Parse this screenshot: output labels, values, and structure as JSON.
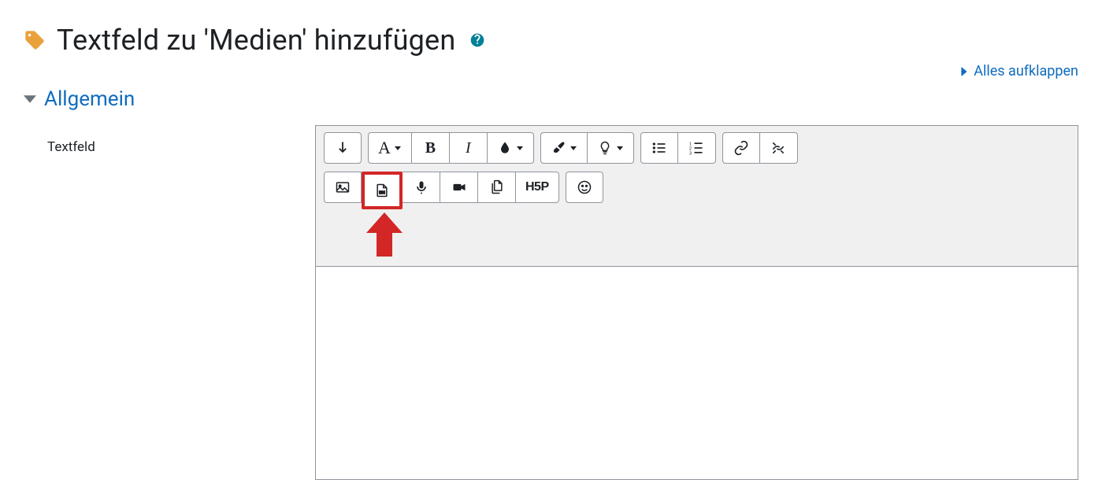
{
  "page": {
    "title": "Textfeld zu 'Medien' hinzufügen"
  },
  "expand": {
    "label": "Alles aufklappen"
  },
  "section": {
    "title": "Allgemein"
  },
  "field": {
    "label": "Textfeld"
  },
  "editor": {
    "content": "",
    "h5p_label": "H5P"
  }
}
